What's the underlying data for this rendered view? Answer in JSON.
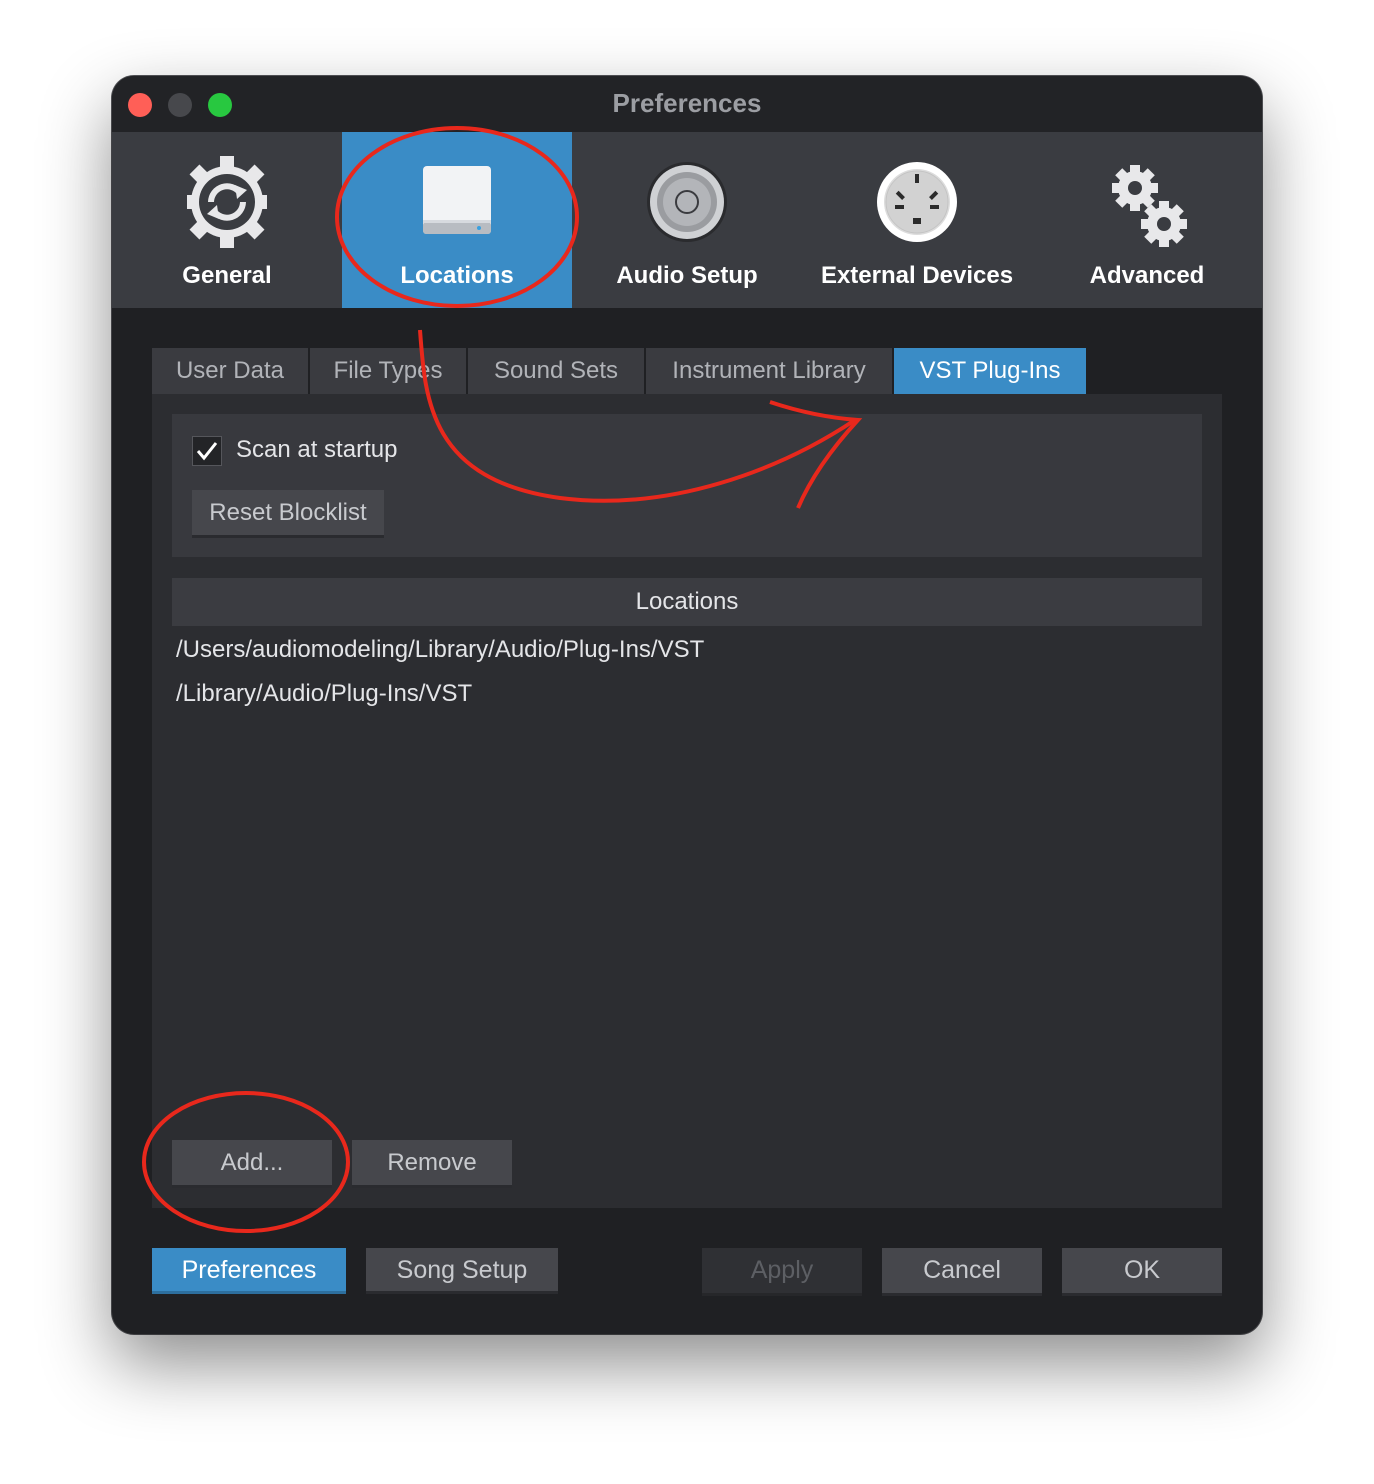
{
  "window": {
    "title": "Preferences"
  },
  "toolbar": {
    "items": [
      {
        "label": "General",
        "icon": "gear-refresh-icon"
      },
      {
        "label": "Locations",
        "icon": "hard-drive-icon",
        "active": true
      },
      {
        "label": "Audio Setup",
        "icon": "speaker-icon"
      },
      {
        "label": "External Devices",
        "icon": "midi-port-icon"
      },
      {
        "label": "Advanced",
        "icon": "gears-icon"
      }
    ]
  },
  "tabs": {
    "items": [
      {
        "label": "User Data"
      },
      {
        "label": "File Types"
      },
      {
        "label": "Sound Sets"
      },
      {
        "label": "Instrument Library"
      },
      {
        "label": "VST Plug-Ins",
        "active": true
      }
    ]
  },
  "vst": {
    "scan_label": "Scan at startup",
    "scan_checked": true,
    "reset_label": "Reset Blocklist",
    "locations_header": "Locations",
    "locations": [
      "/Users/audiomodeling/Library/Audio/Plug-Ins/VST",
      "/Library/Audio/Plug-Ins/VST"
    ],
    "add_label": "Add...",
    "remove_label": "Remove"
  },
  "footer": {
    "preferences_label": "Preferences",
    "song_setup_label": "Song Setup",
    "apply_label": "Apply",
    "cancel_label": "Cancel",
    "ok_label": "OK"
  },
  "colors": {
    "accent": "#3a8cc6",
    "annotation": "#e8281c",
    "window_bg": "#1f2023"
  }
}
